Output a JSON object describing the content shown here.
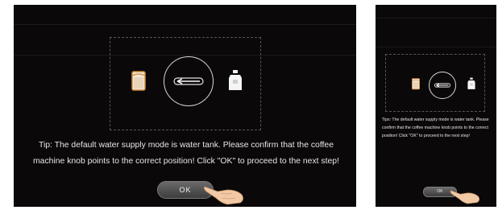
{
  "large_screen": {
    "tip_text": "Tip: The default water supply mode is water tank. Please confirm that the coffee machine knob points to the correct position! Click \"OK\" to proceed to the next step!",
    "ok_label": "OK"
  },
  "small_screen": {
    "tip_text": "Tips: The default water supply mode is water tank. Please confirm that the coffee machine knob points to the correct position! Click \"OK\" to proceed to the next step!",
    "ok_label": "OK"
  },
  "icons": {
    "filter": "water-filter-icon",
    "arrow": "arrow-left-icon",
    "jug": "water-jug-icon",
    "hand": "pointing-hand-icon"
  },
  "colors": {
    "background": "#0b0809",
    "text": "#e6e6e6",
    "filter_accent": "#d08a3a"
  }
}
